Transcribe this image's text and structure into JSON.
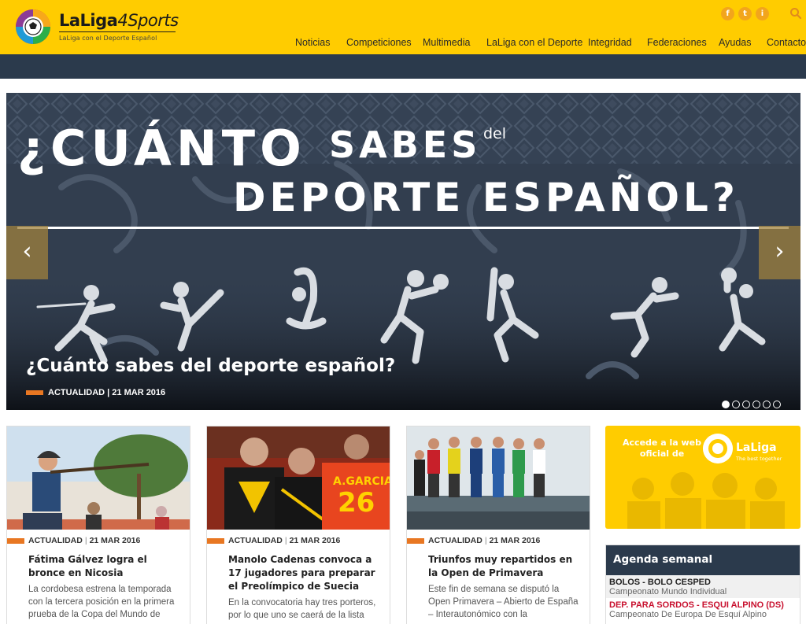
{
  "brand": {
    "name_main": "LaLiga",
    "name_suffix": "4Sports",
    "tagline": "LaLiga con el Deporte Español"
  },
  "social": [
    "f",
    "t",
    "i"
  ],
  "nav": [
    "Noticias",
    "Competiciones",
    "Multimedia",
    "LaLiga con el Deporte",
    "Integridad",
    "Federaciones",
    "Ayudas",
    "Contacto"
  ],
  "slider": {
    "headline_line1_a": "¿CUÁNTO",
    "headline_line1_b": "SABES",
    "headline_line1_c": "del",
    "headline_line2": "DEPORTE ESPAÑOL?",
    "title": "¿Cuánto sabes del deporte español?",
    "meta": "ACTUALIDAD | 21 MAR 2016",
    "prev_icon": "‹",
    "next_icon": "›",
    "slide_count": 6,
    "active_slide": 1
  },
  "cards": [
    {
      "category": "ACTUALIDAD",
      "day": "21",
      "month_year": "MAR 2016",
      "title": "Fátima Gálvez logra el bronce en Nicosia",
      "excerpt": "La cordobesa estrena la temporada con la tercera posición en la primera prueba de la Copa del Mundo de"
    },
    {
      "category": "ACTUALIDAD",
      "day": "21",
      "month_year": "MAR 2016",
      "title": "Manolo Cadenas convoca a 17 jugadores para preparar el Preolímpico de Suecia",
      "excerpt": "En la convocatoria hay tres porteros, por lo que uno se caerá de la lista"
    },
    {
      "category": "ACTUALIDAD",
      "day": "21",
      "month_year": "MAR 2016",
      "title": "Triunfos muy repartidos en la Open de Primavera",
      "excerpt": "Este fin de semana se disputó la Open Primavera – Abierto de España – Interautonómico con la"
    }
  ],
  "card2_jersey": {
    "name": "A.GARCIA",
    "number": "26"
  },
  "banner": {
    "text": "Accede a la web oficial de",
    "brand": "LaLiga",
    "tagline": "The best together"
  },
  "agenda": {
    "heading": "Agenda semanal",
    "items": [
      {
        "sport": "BOLOS - BOLO CESPED",
        "event": "Campeonato Mundo Individual"
      },
      {
        "sport": "DEP. PARA SORDOS - ESQUI ALPINO (DS)",
        "event": "Campeonato De Europa De Esquí Alpino"
      }
    ]
  },
  "colors": {
    "header": "#ffcc00",
    "navy": "#2b3a4c",
    "accent_orange": "#e87722",
    "agenda_red": "#c8102e"
  }
}
